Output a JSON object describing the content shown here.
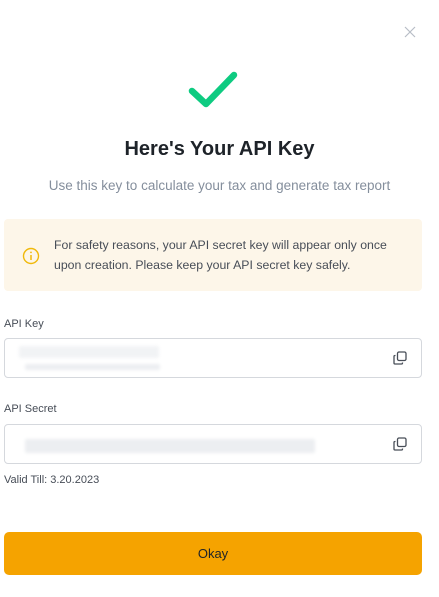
{
  "dialog": {
    "title": "Here's Your API Key",
    "subtitle": "Use this key to calculate your tax and generate tax report",
    "notice": "For safety reasons, your API secret key will appear only once upon creation. Please keep your API secret key safely.",
    "api_key_label": "API Key",
    "api_secret_label": "API Secret",
    "valid_till": "Valid Till: 3.20.2023",
    "okay_label": "Okay"
  },
  "icons": {
    "close": "close-icon",
    "success": "checkmark-icon",
    "notice": "info-icon",
    "copy": "copy-icon"
  },
  "colors": {
    "check": "#0ecb81",
    "primary_button": "#f5a300",
    "notice_bg": "#fdf6e9",
    "notice_icon": "#f0b90b"
  }
}
